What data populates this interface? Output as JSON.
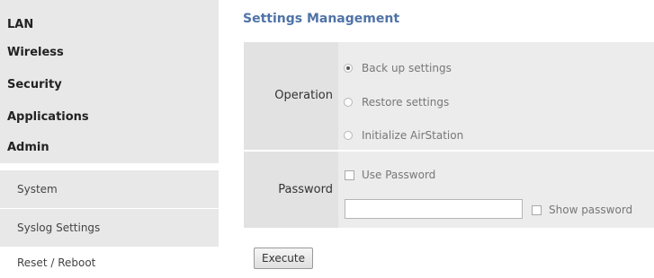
{
  "sidebar": {
    "items": [
      {
        "label": "LAN"
      },
      {
        "label": "Wireless"
      },
      {
        "label": "Security"
      },
      {
        "label": "Applications"
      },
      {
        "label": "Admin"
      }
    ],
    "subitems": [
      {
        "label": "System"
      },
      {
        "label": "Syslog Settings"
      },
      {
        "label": "Reset / Reboot"
      }
    ]
  },
  "main": {
    "title": "Settings Management",
    "operation": {
      "label": "Operation",
      "options": [
        {
          "label": "Back up settings",
          "selected": true
        },
        {
          "label": "Restore settings",
          "selected": false
        },
        {
          "label": "Initialize AirStation",
          "selected": false
        }
      ]
    },
    "password": {
      "label": "Password",
      "use_password_label": "Use Password",
      "input_value": "",
      "show_password_label": "Show password"
    },
    "execute_label": "Execute"
  }
}
